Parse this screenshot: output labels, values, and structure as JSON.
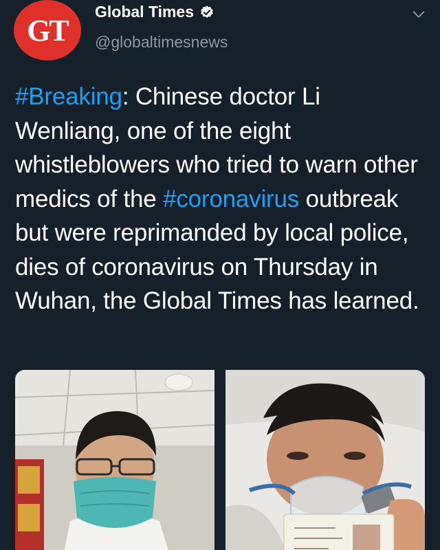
{
  "account": {
    "avatar_text": "GT",
    "display_name": "Global Times",
    "handle": "@globaltimesnews",
    "verified_icon": "verified-badge-icon",
    "menu_icon": "chevron-down-icon"
  },
  "tweet": {
    "hashtag_breaking": "#Breaking",
    "text_part1": ": Chinese doctor Li Wenliang, one of the eight whistleblowers who tried to warn other medics of the ",
    "hashtag_coronavirus": "#coronavirus",
    "text_part2": " outbreak but were reprimanded by local police, dies of coronavirus on Thursday in Wuhan, the Global Times has learned."
  },
  "media": {
    "photos": [
      {
        "description_icon": "photo-doctor-with-mask"
      },
      {
        "description_icon": "photo-doctor-in-hospital-bed"
      }
    ]
  },
  "colors": {
    "background": "#15202b",
    "hashtag": "#1da1f2",
    "secondary_text": "#8899a6",
    "avatar_red": "#e0302a"
  }
}
